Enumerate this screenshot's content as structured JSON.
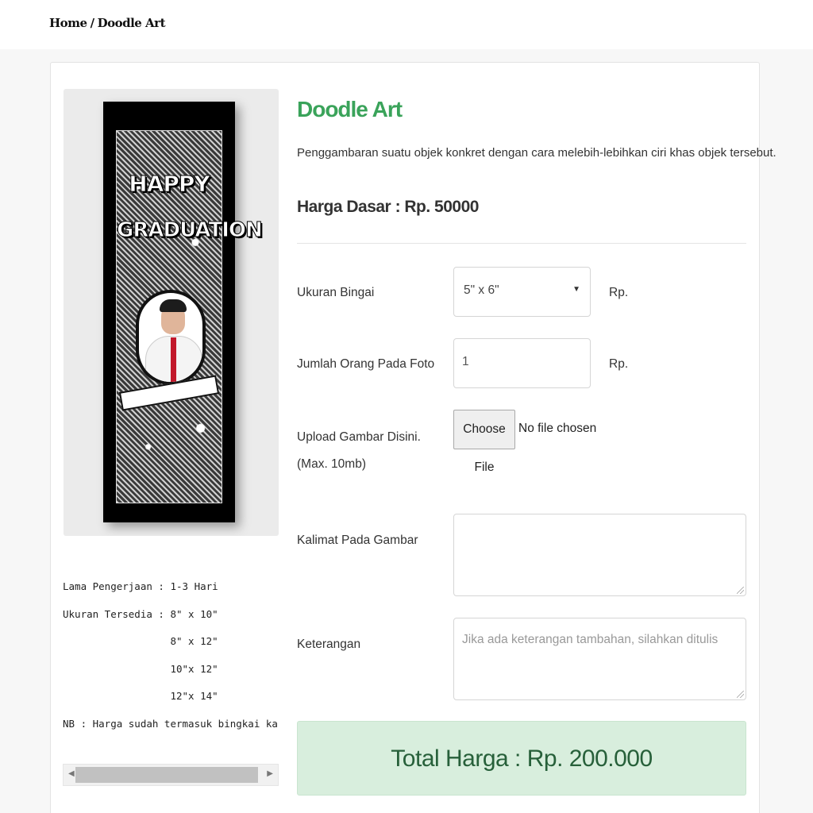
{
  "breadcrumb": {
    "home": "Home",
    "separator": "/",
    "current": "Doodle Art"
  },
  "product": {
    "title": "Doodle Art",
    "description": "Penggambaran suatu objek konkret dengan cara melebih-lebihkan ciri khas objek tersebut.",
    "base_price": "Harga Dasar : Rp. 50000",
    "image": {
      "title_line1": "HAPPY",
      "title_line2": "GRADUATION"
    }
  },
  "specs": {
    "text": "Lama Pengerjaan : 1-3 Hari\nUkuran Tersedia : 8\" x 10\"\n                  8\" x 12\"\n                  10\"x 12\"\n                  12\"x 14\"\nNB : Harga sudah termasuk bingkai kaca(pigura)"
  },
  "form": {
    "frame_size": {
      "label": "Ukuran Bingai",
      "value": "5\" x 6\"",
      "price_suffix": "Rp."
    },
    "people_count": {
      "label": "Jumlah Orang Pada Foto",
      "value": "1",
      "price_suffix": "Rp."
    },
    "upload": {
      "label": "Upload Gambar Disini. (Max. 10mb)",
      "button": "Choose File",
      "status": "No file chosen"
    },
    "caption": {
      "label": "Kalimat Pada Gambar",
      "placeholder": ""
    },
    "notes": {
      "label": "Keterangan",
      "placeholder": "Jika ada keterangan tambahan, silahkan ditulis"
    }
  },
  "total": {
    "text": "Total Harga : Rp. 200.000"
  },
  "colors": {
    "accent_green": "#3aa35a",
    "total_bg": "#d8eedd",
    "total_text": "#27603a"
  }
}
